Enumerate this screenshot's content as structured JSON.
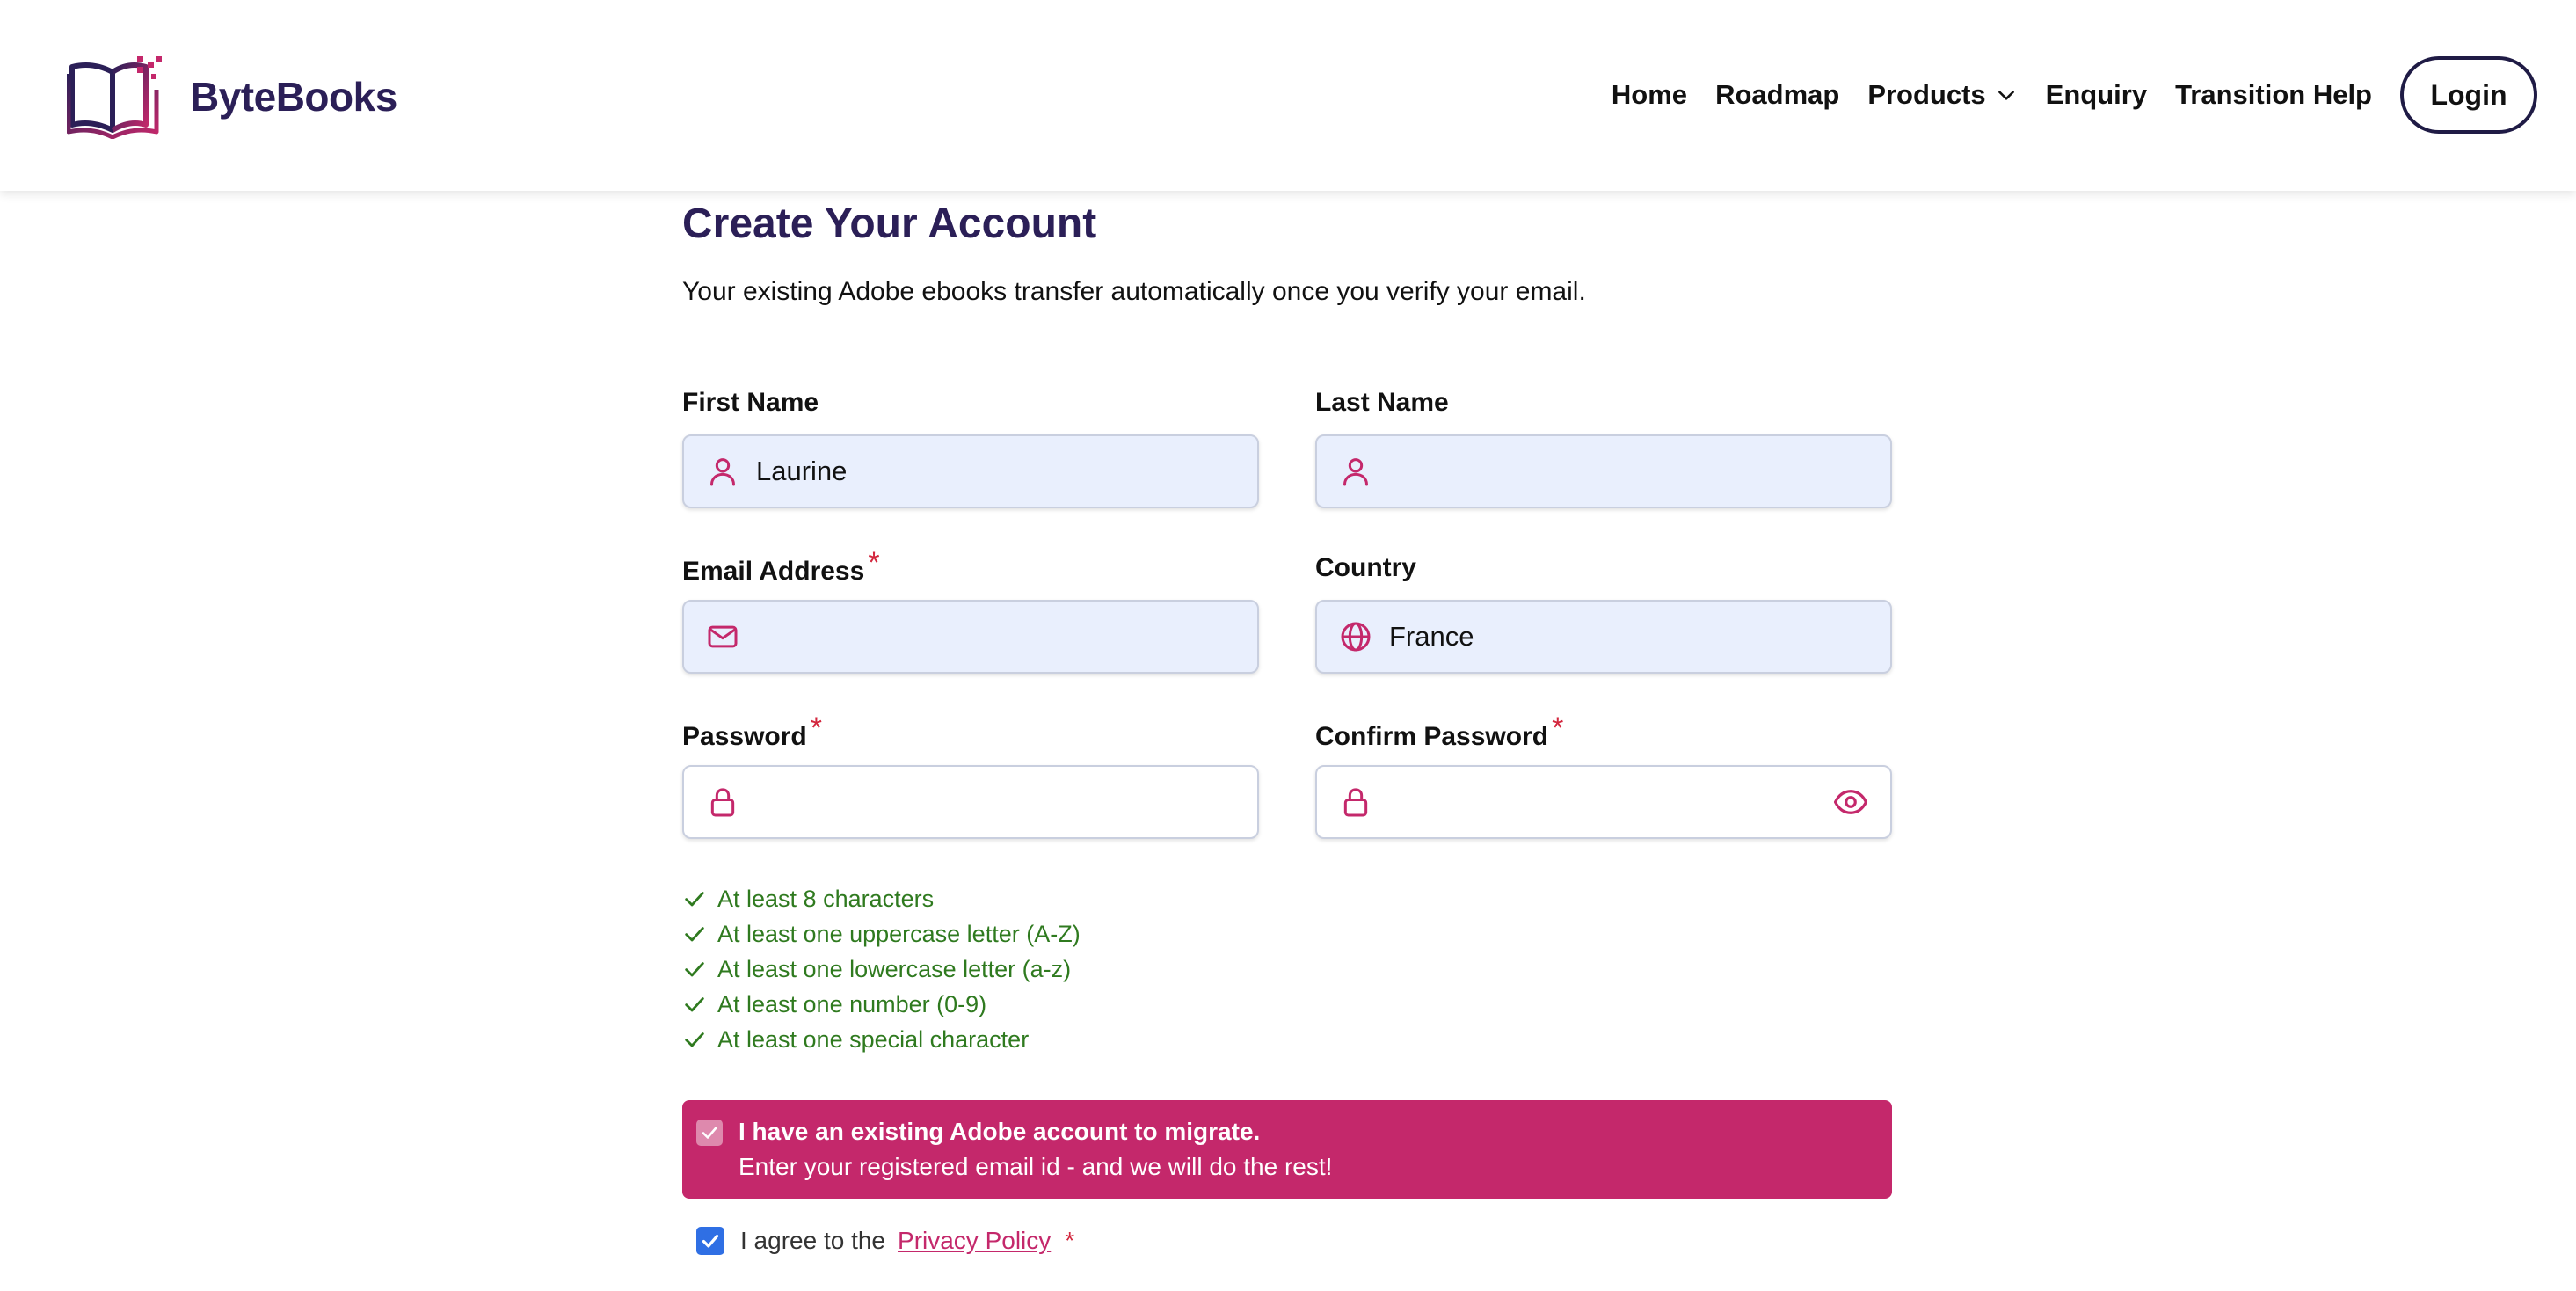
{
  "header": {
    "brand": "ByteBooks",
    "nav": [
      {
        "label": "Home"
      },
      {
        "label": "Roadmap"
      },
      {
        "label": "Products"
      },
      {
        "label": "Enquiry"
      },
      {
        "label": "Transition Help"
      }
    ],
    "login_label": "Login"
  },
  "form": {
    "title": "Create Your Account",
    "subtitle": "Your existing Adobe ebooks transfer automatically once you verify your email.",
    "first_name": {
      "label": "First Name",
      "value": "Laurine",
      "icon": "user-icon"
    },
    "last_name": {
      "label": "Last Name",
      "value": "",
      "icon": "user-icon"
    },
    "email": {
      "label": "Email Address",
      "required_mark": "*",
      "value": "",
      "icon": "mail-icon"
    },
    "country": {
      "label": "Country",
      "value": "France",
      "icon": "globe-icon"
    },
    "password": {
      "label": "Password",
      "required_mark": "*",
      "value": "",
      "icon": "lock-icon"
    },
    "confirm_password": {
      "label": "Confirm Password",
      "required_mark": "*",
      "value": "",
      "icon": "lock-icon"
    },
    "rules": [
      "At least 8 characters",
      "At least one uppercase letter (A-Z)",
      "At least one lowercase letter (a-z)",
      "At least one number (0-9)",
      "At least one special character"
    ],
    "migration": {
      "checked": true,
      "title": "I have an existing Adobe account to migrate.",
      "text": "Enter your registered email id - and we will do the rest!"
    },
    "agree": {
      "checked": true,
      "text": "I agree to the",
      "link": "Privacy Policy",
      "required_mark": "*"
    }
  },
  "colors": {
    "brand_navy": "#2b1f57",
    "accent_magenta": "#c4286b",
    "rule_green": "#2f7a1f",
    "input_fill": "#e9effd",
    "required_red": "#d3273e",
    "checkbox_blue": "#2f6fe4"
  }
}
